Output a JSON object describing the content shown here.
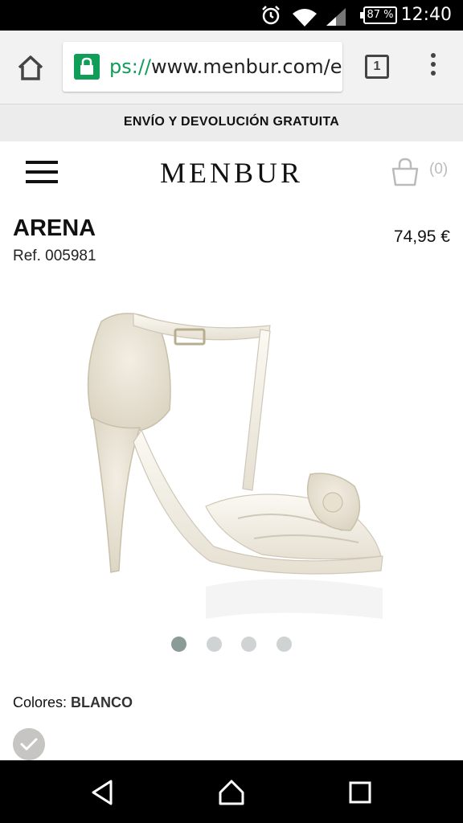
{
  "status_bar": {
    "time": "12:40",
    "battery": "87 %",
    "icons": [
      "alarm-icon",
      "wifi-icon",
      "signal-icon",
      "battery-icon"
    ]
  },
  "browser": {
    "url_scheme": "ps://",
    "url_rest": "www.menbur.com/e",
    "tab_count": "1"
  },
  "promo": {
    "text": "ENVÍO Y DEVOLUCIÓN GRATUITA"
  },
  "header": {
    "logo": "MENBUR",
    "cart_count": "(0)"
  },
  "product": {
    "name": "ARENA",
    "ref": "Ref. 005981",
    "price": "74,95 €",
    "colors_label": "Colores:",
    "colors_value": "BLANCO",
    "carousel": {
      "count": 4,
      "active": 1
    }
  },
  "colors": {
    "accent_green": "#0f9d58",
    "dot_active": "#8a9b98",
    "dot_inactive": "#cfd3d3"
  }
}
